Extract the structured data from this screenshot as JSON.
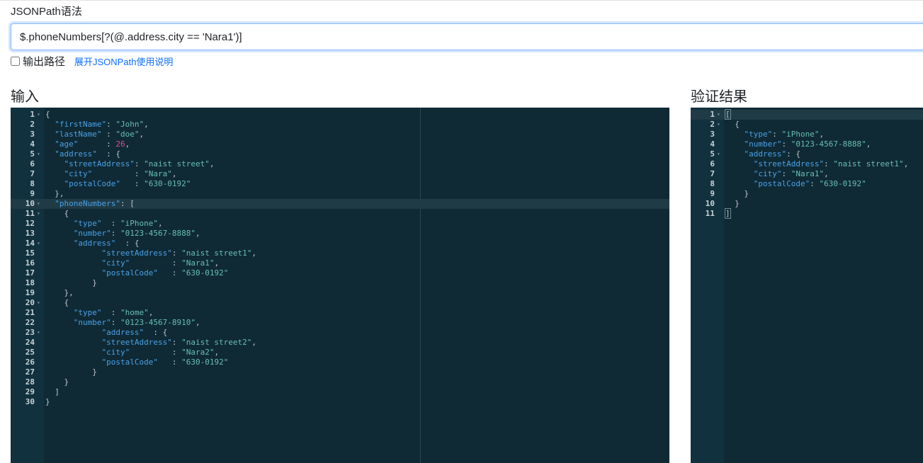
{
  "query": {
    "label": "JSONPath语法",
    "value": "$.phoneNumbers[?(@.address.city == 'Nara1')]"
  },
  "options": {
    "output_path_label": "输出路径",
    "output_path_checked": false,
    "help_link": "展开JSONPath使用说明"
  },
  "input_panel": {
    "title": "输入",
    "active_line": 10,
    "lines": [
      [
        [
          "{",
          "pun"
        ]
      ],
      [
        [
          "  "
        ],
        [
          "\"firstName\"",
          "key"
        ],
        [
          ": ",
          "pun"
        ],
        [
          "\"John\"",
          "str"
        ],
        [
          ",",
          "pun"
        ]
      ],
      [
        [
          "  "
        ],
        [
          "\"lastName\"",
          "key"
        ],
        [
          " : ",
          "pun"
        ],
        [
          "\"doe\"",
          "str"
        ],
        [
          ",",
          "pun"
        ]
      ],
      [
        [
          "  "
        ],
        [
          "\"age\"",
          "key"
        ],
        [
          "      : ",
          "pun"
        ],
        [
          "26",
          "num"
        ],
        [
          ",",
          "pun"
        ]
      ],
      [
        [
          "  "
        ],
        [
          "\"address\"",
          "key"
        ],
        [
          "  : {",
          "pun"
        ]
      ],
      [
        [
          "    "
        ],
        [
          "\"streetAddress\"",
          "key"
        ],
        [
          ": ",
          "pun"
        ],
        [
          "\"naist street\"",
          "str"
        ],
        [
          ",",
          "pun"
        ]
      ],
      [
        [
          "    "
        ],
        [
          "\"city\"",
          "key"
        ],
        [
          "         : ",
          "pun"
        ],
        [
          "\"Nara\"",
          "str"
        ],
        [
          ",",
          "pun"
        ]
      ],
      [
        [
          "    "
        ],
        [
          "\"postalCode\"",
          "key"
        ],
        [
          "   : ",
          "pun"
        ],
        [
          "\"630-0192\"",
          "str"
        ]
      ],
      [
        [
          "  },",
          "pun"
        ]
      ],
      [
        [
          "  "
        ],
        [
          "\"phoneNumbers\"",
          "key"
        ],
        [
          ": [",
          "pun"
        ]
      ],
      [
        [
          "    {",
          "pun"
        ]
      ],
      [
        [
          "      "
        ],
        [
          "\"type\"",
          "key"
        ],
        [
          "  : ",
          "pun"
        ],
        [
          "\"iPhone\"",
          "str"
        ],
        [
          ",",
          "pun"
        ]
      ],
      [
        [
          "      "
        ],
        [
          "\"number\"",
          "key"
        ],
        [
          ": ",
          "pun"
        ],
        [
          "\"0123-4567-8888\"",
          "str"
        ],
        [
          ",",
          "pun"
        ]
      ],
      [
        [
          "      "
        ],
        [
          "\"address\"",
          "key"
        ],
        [
          "  : {",
          "pun"
        ]
      ],
      [
        [
          "            "
        ],
        [
          "\"streetAddress\"",
          "key"
        ],
        [
          ": ",
          "pun"
        ],
        [
          "\"naist street1\"",
          "str"
        ],
        [
          ",",
          "pun"
        ]
      ],
      [
        [
          "            "
        ],
        [
          "\"city\"",
          "key"
        ],
        [
          "         : ",
          "pun"
        ],
        [
          "\"Nara1\"",
          "str"
        ],
        [
          ",",
          "pun"
        ]
      ],
      [
        [
          "            "
        ],
        [
          "\"postalCode\"",
          "key"
        ],
        [
          "   : ",
          "pun"
        ],
        [
          "\"630-0192\"",
          "str"
        ]
      ],
      [
        [
          "          }",
          "pun"
        ]
      ],
      [
        [
          "    },",
          "pun"
        ]
      ],
      [
        [
          "    {",
          "pun"
        ]
      ],
      [
        [
          "      "
        ],
        [
          "\"type\"",
          "key"
        ],
        [
          "  : ",
          "pun"
        ],
        [
          "\"home\"",
          "str"
        ],
        [
          ",",
          "pun"
        ]
      ],
      [
        [
          "      "
        ],
        [
          "\"number\"",
          "key"
        ],
        [
          ": ",
          "pun"
        ],
        [
          "\"0123-4567-8910\"",
          "str"
        ],
        [
          ",",
          "pun"
        ]
      ],
      [
        [
          "            "
        ],
        [
          "\"address\"",
          "key"
        ],
        [
          "  : {",
          "pun"
        ]
      ],
      [
        [
          "            "
        ],
        [
          "\"streetAddress\"",
          "key"
        ],
        [
          ": ",
          "pun"
        ],
        [
          "\"naist street2\"",
          "str"
        ],
        [
          ",",
          "pun"
        ]
      ],
      [
        [
          "            "
        ],
        [
          "\"city\"",
          "key"
        ],
        [
          "         : ",
          "pun"
        ],
        [
          "\"Nara2\"",
          "str"
        ],
        [
          ",",
          "pun"
        ]
      ],
      [
        [
          "            "
        ],
        [
          "\"postalCode\"",
          "key"
        ],
        [
          "   : ",
          "pun"
        ],
        [
          "\"630-0192\"",
          "str"
        ]
      ],
      [
        [
          "          }",
          "pun"
        ]
      ],
      [
        [
          "    }",
          "pun"
        ]
      ],
      [
        [
          "  ]",
          "pun"
        ]
      ],
      [
        [
          "}",
          "pun"
        ]
      ]
    ],
    "fold_lines": [
      1,
      5,
      10,
      11,
      14,
      20,
      23
    ]
  },
  "result_panel": {
    "title": "验证结果",
    "active_line": 1,
    "lines": [
      [
        [
          "[",
          "pun"
        ]
      ],
      [
        [
          "  {",
          "pun"
        ]
      ],
      [
        [
          "    "
        ],
        [
          "\"type\"",
          "key"
        ],
        [
          ": ",
          "pun"
        ],
        [
          "\"iPhone\"",
          "str"
        ],
        [
          ",",
          "pun"
        ]
      ],
      [
        [
          "    "
        ],
        [
          "\"number\"",
          "key"
        ],
        [
          ": ",
          "pun"
        ],
        [
          "\"0123-4567-8888\"",
          "str"
        ],
        [
          ",",
          "pun"
        ]
      ],
      [
        [
          "    "
        ],
        [
          "\"address\"",
          "key"
        ],
        [
          ": {",
          "pun"
        ]
      ],
      [
        [
          "      "
        ],
        [
          "\"streetAddress\"",
          "key"
        ],
        [
          ": ",
          "pun"
        ],
        [
          "\"naist street1\"",
          "str"
        ],
        [
          ",",
          "pun"
        ]
      ],
      [
        [
          "      "
        ],
        [
          "\"city\"",
          "key"
        ],
        [
          ": ",
          "pun"
        ],
        [
          "\"Nara1\"",
          "str"
        ],
        [
          ",",
          "pun"
        ]
      ],
      [
        [
          "      "
        ],
        [
          "\"postalCode\"",
          "key"
        ],
        [
          ": ",
          "pun"
        ],
        [
          "\"630-0192\"",
          "str"
        ]
      ],
      [
        [
          "    }",
          "pun"
        ]
      ],
      [
        [
          "  }",
          "pun"
        ]
      ],
      [
        [
          "]",
          "pun"
        ]
      ]
    ],
    "fold_lines": [
      1,
      2,
      5
    ]
  }
}
